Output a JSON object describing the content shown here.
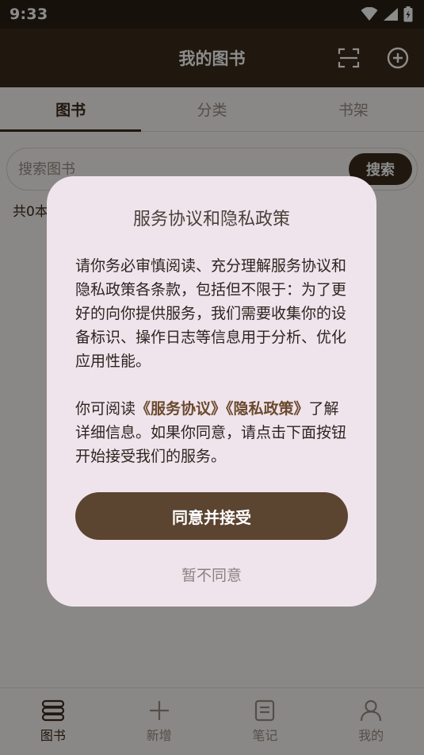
{
  "status": {
    "time": "9:33"
  },
  "app_bar": {
    "title": "我的图书",
    "scan_icon": "scan-icon",
    "add_icon": "add-circle-icon"
  },
  "tabs": [
    {
      "label": "图书",
      "active": true
    },
    {
      "label": "分类",
      "active": false
    },
    {
      "label": "书架",
      "active": false
    }
  ],
  "search": {
    "placeholder": "搜索图书",
    "button_label": "搜索"
  },
  "book_count": "共0本",
  "bottom_nav": [
    {
      "label": "图书",
      "icon": "books-icon",
      "active": true
    },
    {
      "label": "新增",
      "icon": "plus-icon",
      "active": false
    },
    {
      "label": "笔记",
      "icon": "note-icon",
      "active": false
    },
    {
      "label": "我的",
      "icon": "person-icon",
      "active": false
    }
  ],
  "dialog": {
    "title": "服务协议和隐私政策",
    "paragraph1": "请你务必审慎阅读、充分理解服务协议和隐私政策各条款，包括但不限于：为了更好的向你提供服务，我们需要收集你的设备标识、操作日志等信息用于分析、优化应用性能。",
    "paragraph2_prefix": "你可阅读",
    "service_link": "《服务协议》",
    "privacy_link": "《隐私政策》",
    "paragraph2_suffix": "了解详细信息。如果你同意，请点击下面按钮开始接受我们的服务。",
    "agree_label": "同意并接受",
    "decline_label": "暂不同意"
  },
  "colors": {
    "primary": "#3b2a1c",
    "dialog_bg": "#f0e4ec",
    "agree_button": "#5b4430"
  }
}
